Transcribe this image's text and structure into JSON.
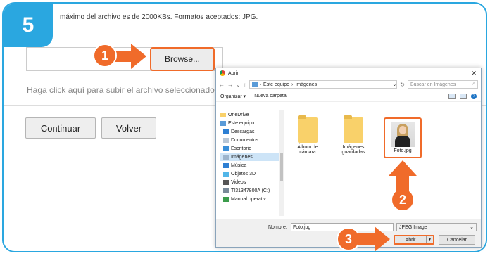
{
  "step": {
    "number": "5"
  },
  "page": {
    "note": "máximo del archivo es de 2000KBs. Formatos aceptados: JPG.",
    "browse_label": "Browse...",
    "upload_link": "Haga click aquí para subir el archivo seleccionado.",
    "continue_label": "Continuar",
    "back_label": "Volver"
  },
  "callouts": {
    "one": "1",
    "two": "2",
    "three": "3"
  },
  "dialog": {
    "title": "Abrir",
    "close": "✕",
    "nav": {
      "back": "←",
      "forward": "→",
      "recent": "⌄",
      "up": "↑",
      "refresh": "↻",
      "dropdown": "⌄"
    },
    "breadcrumb": [
      "Este equipo",
      "Imágenes"
    ],
    "breadcrumb_sep": "›",
    "search_placeholder": "Buscar en Imágenes",
    "search_icon": "⌕",
    "organize_label": "Organizar ▾",
    "new_folder_label": "Nueva carpeta",
    "help_label": "?",
    "tree": [
      {
        "label": "OneDrive",
        "icon": "folder-icon"
      },
      {
        "label": "Este equipo",
        "icon": "computer-icon"
      },
      {
        "label": "Descargas",
        "icon": "download-icon"
      },
      {
        "label": "Documentos",
        "icon": "document-icon"
      },
      {
        "label": "Escritorio",
        "icon": "desktop-icon"
      },
      {
        "label": "Imágenes",
        "icon": "pictures-icon",
        "selected": true
      },
      {
        "label": "Música",
        "icon": "music-icon"
      },
      {
        "label": "Objetos 3D",
        "icon": "cube-icon"
      },
      {
        "label": "Videos",
        "icon": "video-icon"
      },
      {
        "label": "TI31347800A (C:)",
        "icon": "drive-icon"
      },
      {
        "label": "Manual operativ",
        "icon": "network-drive-icon"
      }
    ],
    "folders": [
      {
        "label": "Álbum de cámara"
      },
      {
        "label": "Imágenes guardadas"
      }
    ],
    "file": {
      "label": "Foto.jpg"
    },
    "name_label": "Nombre:",
    "name_value": "Foto.jpg",
    "type_value": "JPEG Image",
    "open_label": "Abrir",
    "cancel_label": "Cancelar"
  },
  "colors": {
    "accent": "#2aa7e0",
    "callout": "#f06b2a"
  }
}
